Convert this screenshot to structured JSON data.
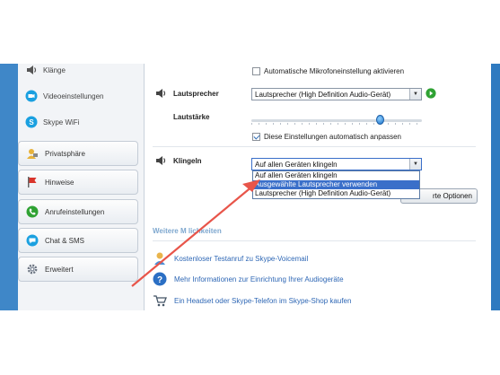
{
  "sidebar": {
    "sub_items": [
      {
        "label": "Klänge",
        "icon": "speaker-icon"
      },
      {
        "label": "Videoeinstellungen",
        "icon": "video-icon"
      },
      {
        "label": "Skype WiFi",
        "icon": "skype-wifi-icon"
      }
    ],
    "buttons": [
      {
        "label": "Privatsphäre",
        "icon": "privacy-icon"
      },
      {
        "label": "Hinweise",
        "icon": "flag-icon"
      },
      {
        "label": "Anrufeinstellungen",
        "icon": "phone-icon"
      },
      {
        "label": "Chat & SMS",
        "icon": "chat-icon"
      },
      {
        "label": "Erweitert",
        "icon": "gear-icon"
      }
    ]
  },
  "audio": {
    "auto_mic_label": "Automatische Mikrofoneinstellung aktivieren",
    "auto_mic_checked": false,
    "speaker_label": "Lautsprecher",
    "speaker_value": "Lautsprecher (High Definition Audio-Gerät)",
    "volume_label": "Lautstärke",
    "volume_level": 0.75,
    "auto_adjust_label": "Diese Einstellungen automatisch anpassen",
    "auto_adjust_checked": true,
    "ringing_label": "Klingeln",
    "ringing_value": "Auf allen Geräten klingeln",
    "ringing_options": [
      "Auf allen Geräten klingeln",
      "Ausgewählte Lautsprecher verwenden",
      "Lautsprecher (High Definition Audio-Gerät)"
    ],
    "ringing_highlighted_index": 1,
    "advanced_button_visible": "rte Optionen"
  },
  "more": {
    "title_visible": "Weitere M  lichkeiten",
    "links": [
      "Kostenloser Testanruf zu Skype-Voicemail",
      "Mehr Informationen zur Einrichtung Ihrer Audiogeräte",
      "Ein Headset oder Skype-Telefon im Skype-Shop kaufen"
    ]
  },
  "colors": {
    "accent": "#3f87c8",
    "link": "#2e67b5",
    "annotation_arrow": "#e8554a",
    "play_button": "#2fa233"
  }
}
